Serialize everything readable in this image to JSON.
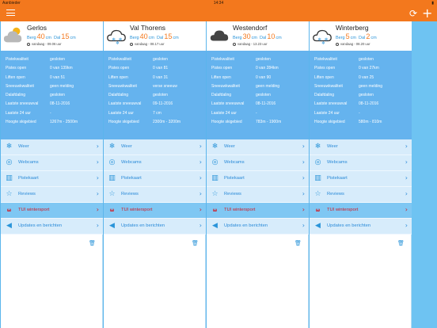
{
  "status_bar": {
    "carrier": "Aanbieder",
    "time": "14:34",
    "battery": "▮"
  },
  "toolbar": {
    "menu_label": "menu",
    "refresh_glyph": "⟳",
    "add_glyph": "+"
  },
  "colors": {
    "accent": "#f3781d",
    "blue": "#2a94d9",
    "info_bg": "#65b3ee",
    "nav_bg": "#d7ecfb",
    "tui_red": "#d21a25"
  },
  "labels": {
    "berg": "Berg",
    "dal": "Dal",
    "unit": "cm",
    "rows": [
      "Pistekwaliteit",
      "Pistes open",
      "Liften open",
      "Sneeuwkwaliteit",
      "Dalafdaling",
      "Laatste sneeuwval",
      "Laatste 24 uur",
      "Hoogte skigebied"
    ],
    "nav": [
      "Weer",
      "Webcams",
      "Pistekaart",
      "Reviews",
      "TUI wintersport",
      "Updates en berichten"
    ]
  },
  "resorts": [
    {
      "name": "Gerlos",
      "weather_icon": "partly-cloudy-sun-icon",
      "berg": "40",
      "dal": "15",
      "updated": "vandaag - 09.06 uur",
      "values": [
        "gesloten",
        "0 van 139km",
        "0 van 51",
        "geen melding",
        "gesloten",
        "08-11-2016",
        "-",
        "1267m - 2500m"
      ]
    },
    {
      "name": "Val Thorens",
      "weather_icon": "cloud-snow-icon",
      "berg": "40",
      "dal": "15",
      "updated": "vandaag - 08.17 uur",
      "values": [
        "gesloten",
        "0 van 81",
        "0 van 31",
        "verse sneeuw",
        "gesloten",
        "09-11-2016",
        "7 cm",
        "2300m - 3200m"
      ]
    },
    {
      "name": "Westendorf",
      "weather_icon": "cloud-icon",
      "berg": "30",
      "dal": "10",
      "updated": "vandaag - 13.23 uur",
      "values": [
        "gesloten",
        "0 van 284km",
        "0 van 90",
        "geen melding",
        "gesloten",
        "08-11-2016",
        "-",
        "783m - 1900m"
      ]
    },
    {
      "name": "Winterberg",
      "weather_icon": "cloud-snow-icon",
      "berg": "5",
      "dal": "2",
      "updated": "vandaag - 08.20 uur",
      "values": [
        "gesloten",
        "0 van 27km",
        "0 van 25",
        "geen melding",
        "gesloten",
        "08-11-2016",
        "-",
        "580m - 810m"
      ]
    }
  ]
}
